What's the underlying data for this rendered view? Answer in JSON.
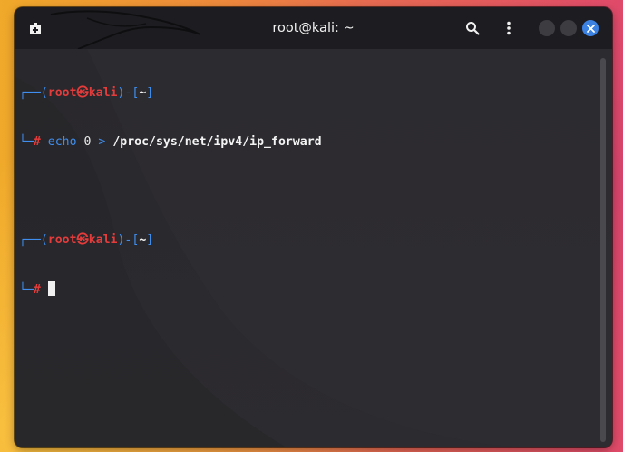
{
  "window": {
    "title": "root@kali: ~"
  },
  "titlebar_icons": {
    "new_tab": "new-tab-icon",
    "search": "search-icon",
    "menu": "kebab-menu-icon",
    "close": "close-icon"
  },
  "colors": {
    "prompt_frame": "#3f8ef0",
    "prompt_user": "#e43b3b",
    "command_text": "#f4f4f4",
    "command_word": "#3f8ef0",
    "close_button": "#3b82e3",
    "terminal_bg": "#2b2a2d",
    "titlebar_bg": "#1d1c20"
  },
  "terminal": {
    "line1": {
      "frame_start": "┌──(",
      "user": "root㉿kali",
      "frame_mid": ")-[",
      "dir": "~",
      "frame_end": "]"
    },
    "line2": {
      "frame": "└─",
      "prompt": "#",
      "cmd_word": "echo",
      "arg": "0",
      "redirect": ">",
      "path": "/proc/sys/net/ipv4/ip_forward"
    },
    "line3": {
      "frame_start": "┌──(",
      "user": "root㉿kali",
      "frame_mid": ")-[",
      "dir": "~",
      "frame_end": "]"
    },
    "line4": {
      "frame": "└─",
      "prompt": "#"
    }
  }
}
